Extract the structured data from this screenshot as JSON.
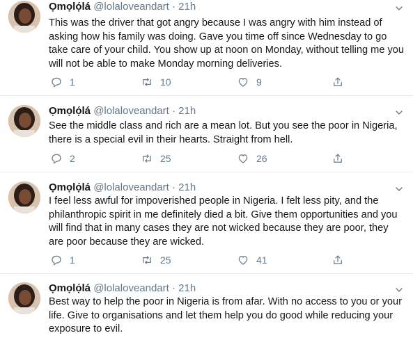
{
  "tweets": [
    {
      "name": "Ọmọlọ́lá",
      "handle": "@lolaloveandart",
      "time": "21h",
      "text": "This was the driver that got angry  because I was angry with him instead of asking how his family was doing. Gave you time off since Wednesday to go take care of your child. You show up at noon on Monday, without telling me you will not be able to make Monday morning deliveries.",
      "replies": "1",
      "retweets": "10",
      "likes": "9"
    },
    {
      "name": "Ọmọlọ́lá",
      "handle": "@lolaloveandart",
      "time": "21h",
      "text": "See the middle class and rich are a mean lot. But you see the poor in Nigeria, there  is a special evil in their hearts. Straight from hell.",
      "replies": "2",
      "retweets": "25",
      "likes": "26"
    },
    {
      "name": "Ọmọlọ́lá",
      "handle": "@lolaloveandart",
      "time": "21h",
      "text": "I feel less awful for impoverished people in Nigeria. I felt less pity, and the philanthropic spirit in me definitely died a bit. Give them opportunities and you will find that in many cases they are not wicked because they are poor, they are poor because they are wicked.",
      "replies": "1",
      "retweets": "25",
      "likes": "41"
    },
    {
      "name": "Ọmọlọ́lá",
      "handle": "@lolaloveandart",
      "time": "21h",
      "text": "Best way to help the poor in Nigeria is from afar. With no access to you or your life. Give to organisations and let them help you do good while reducing your exposure to evil."
    }
  ],
  "colors": {
    "text": "#14171a",
    "secondary": "#657786",
    "divider": "#e6ecf0"
  },
  "icons": [
    "reply-icon",
    "retweet-icon",
    "like-icon",
    "share-icon",
    "chevron-down-icon"
  ]
}
